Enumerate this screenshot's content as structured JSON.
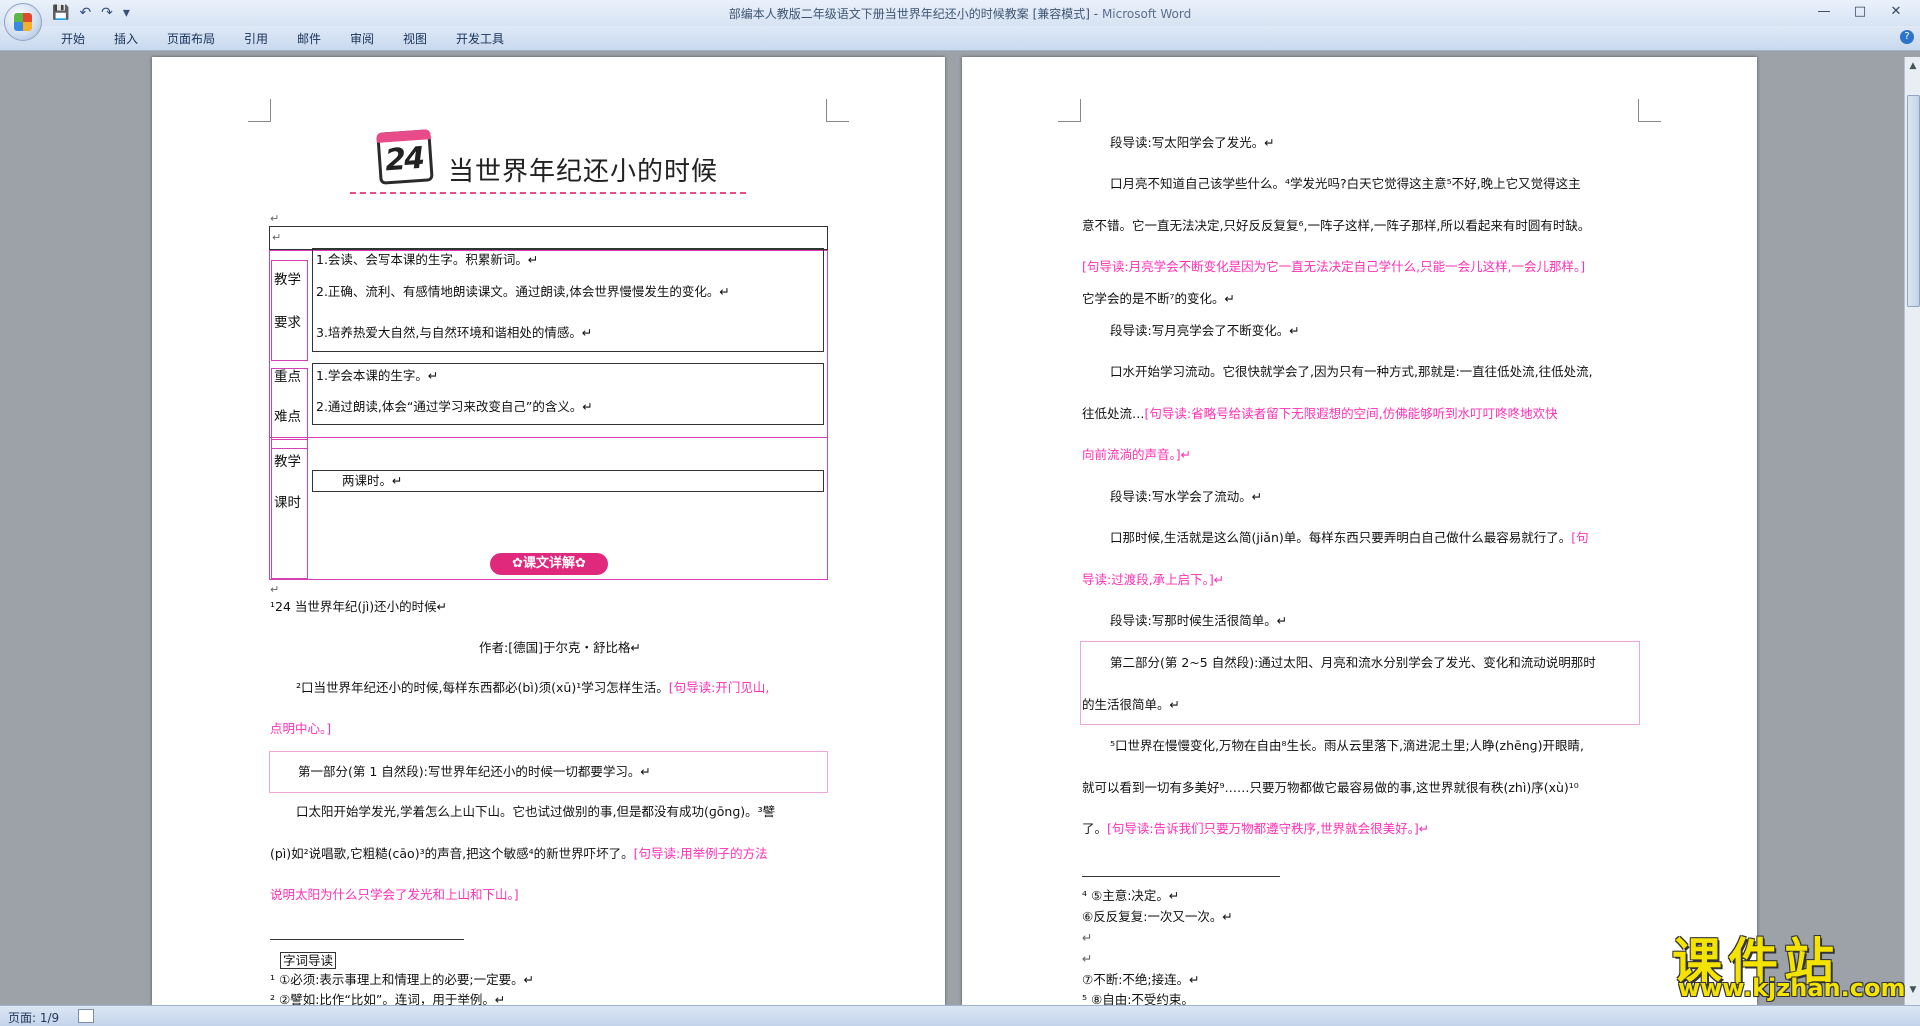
{
  "window": {
    "title": "部编本人教版二年级语文下册当世界年纪还小的时候教案 [兼容模式] -",
    "app_name": "Microsoft Word",
    "controls": [
      "—",
      "□",
      "✕"
    ]
  },
  "quick_access": {
    "save_icon": "💾",
    "undo_icon": "↶",
    "redo_icon": "↷",
    "more_icon": "▾"
  },
  "ribbon": {
    "tabs": [
      "开始",
      "插入",
      "页面布局",
      "引用",
      "邮件",
      "审阅",
      "视图",
      "开发工具"
    ],
    "help": "?"
  },
  "status_bar": {
    "page_info": "页面: 1/9"
  },
  "page1": {
    "lesson_number": "24",
    "title": "当世界年纪还小的时候",
    "table": {
      "req_label_1": "教学",
      "req_label_2": "要求",
      "req_items": [
        "1.会读、会写本课的生字。积累新词。↵",
        "2.正确、流利、有感情地朗读课文。通过朗读,体会世界慢慢发生的变化。↵",
        "3.培养热爱大自然,与自然环境和谐相处的情感。↵"
      ],
      "key_label_1": "重点",
      "key_label_2": "难点",
      "key_items": [
        "1.学会本课的生字。↵",
        "2.通过朗读,体会“通过学习来改变自己”的含义。↵"
      ],
      "time_label_1": "教学",
      "time_label_2": "课时",
      "time_value": "两课时。↵"
    },
    "badge": "✿课文详解✿",
    "lines": [
      "¹24   当世界年纪(jì)还小的时候↵",
      "作者:[德国]于尔克・舒比格↵",
      "²口当世界年纪还小的时候,每样东西都必(bì)须(xū)¹学习怎样生活。",
      "[句导读:开门见山,",
      "点明中心。]",
      "第一部分(第 1 自然段):写世界年纪还小的时候一切都要学习。↵",
      "口太阳开始学发光,学着怎么上山下山。它也试过做别的事,但是都没有成功(ɡōnɡ)。³譬",
      "(pì)如²说唱歌,它粗糙(cāo)³的声音,把这个敏感⁴的新世界吓坏了。",
      "[句导读:用举例子的方法",
      "说明太阳为什么只学会了发光和上山和下山。]"
    ],
    "footnote_head": "字词导读",
    "footnotes": [
      "¹ ①必须:表示事理上和情理上的必要;一定要。↵",
      "² ②譬如:比作“比如”。连词，用于举例。↵"
    ]
  },
  "page2": {
    "lines": [
      "段导读:写太阳学会了发光。↵",
      "口月亮不知道自己该学些什么。⁴学发光吗?白天它觉得这主意⁵不好,晚上它又觉得这主",
      "意不错。它一直无法决定,只好反反复复⁶,一阵子这样,一阵子那样,所以看起来有时圆有时缺。",
      "[句导读:月亮学会不断变化是因为它一直无法决定自己学什么,只能一会儿这样,一会儿那样。]",
      "它学会的是不断⁷的变化。↵",
      "段导读:写月亮学会了不断变化。↵",
      "口水开始学习流动。它很快就学会了,因为只有一种方式,那就是:一直往低处流,往低处流,",
      "往低处流…",
      "[句导读:省略号给读者留下无限遐想的空间,仿佛能够听到水叮叮咚咚地欢快",
      "向前流淌的声音。]↵",
      "段导读:写水学会了流动。↵",
      "口那时候,生活就是这么简(jiǎn)单。每样东西只要弄明白自己做什么最容易就行了。",
      "[句",
      "导读:过渡段,承上启下。]↵",
      "段导读:写那时候生活很简单。↵",
      "第二部分(第 2~5 自然段):通过太阳、月亮和流水分别学会了发光、变化和流动说明那时",
      "的生活很简单。↵",
      "⁵口世界在慢慢变化,万物在自由⁸生长。雨从云里落下,滴进泥土里;人睁(zhēnɡ)开眼睛,",
      "就可以看到一切有多美好⁹……只要万物都做它最容易做的事,这世界就很有秩(zhì)序(xù)¹⁰",
      "了。",
      "[句导读:告诉我们只要万物都遵守秩序,世界就会很美好。]↵"
    ],
    "footnotes": [
      "⁴ ⑤主意:决定。↵",
      "⑥反反复复:一次又一次。↵",
      "↵",
      "↵",
      "⑦不断:不绝;接连。↵",
      "⁵ ⑧自由:不受约束。"
    ]
  },
  "watermark": {
    "text": "课件站",
    "url": "www.kjzhan.com"
  },
  "colors": {
    "guide_pink": "#ff2fb5",
    "table_border": "#d43fb2",
    "badge": "#e0287d"
  }
}
